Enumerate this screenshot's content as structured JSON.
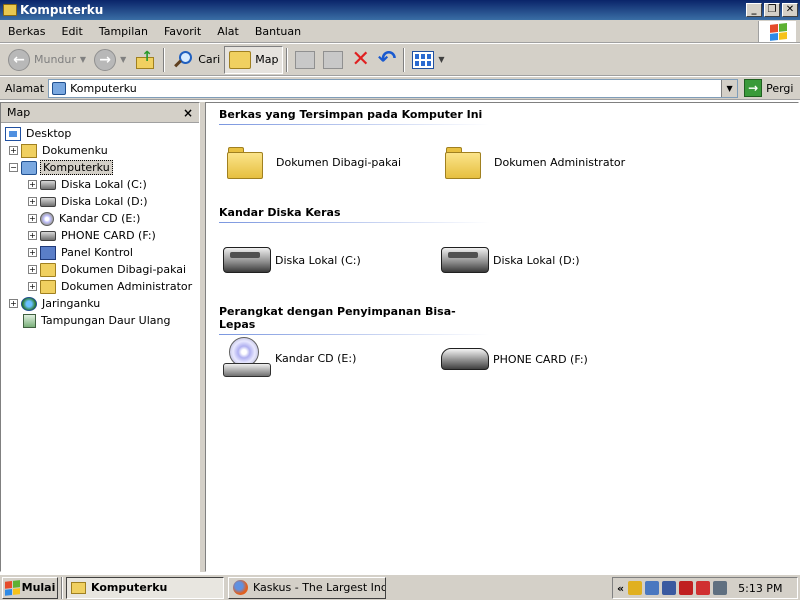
{
  "window": {
    "title": "Komputerku"
  },
  "menu": [
    "Berkas",
    "Edit",
    "Tampilan",
    "Favorit",
    "Alat",
    "Bantuan"
  ],
  "toolbar": {
    "back_label": "Mundur",
    "search_label": "Cari",
    "folders_label": "Map"
  },
  "address": {
    "label": "Alamat",
    "value": "Komputerku",
    "go_label": "Pergi"
  },
  "tree": {
    "header": "Map",
    "items": [
      {
        "label": "Desktop",
        "icon": "desktop-icon"
      },
      {
        "label": "Dokumenku",
        "icon": "documents-icon"
      },
      {
        "label": "Komputerku",
        "icon": "my-computer-icon"
      },
      {
        "label": "Diska Lokal (C:)",
        "icon": "hard-drive-icon"
      },
      {
        "label": "Diska Lokal (D:)",
        "icon": "hard-drive-icon"
      },
      {
        "label": "Kandar CD (E:)",
        "icon": "cd-drive-icon"
      },
      {
        "label": "PHONE CARD (F:)",
        "icon": "removable-drive-icon"
      },
      {
        "label": "Panel Kontrol",
        "icon": "control-panel-icon"
      },
      {
        "label": "Dokumen Dibagi-pakai",
        "icon": "folder-icon"
      },
      {
        "label": "Dokumen Administrator",
        "icon": "folder-icon"
      },
      {
        "label": "Jaringanku",
        "icon": "network-icon"
      },
      {
        "label": "Tampungan Daur Ulang",
        "icon": "recycle-bin-icon"
      }
    ]
  },
  "content": {
    "groups": [
      {
        "title": "Berkas yang Tersimpan pada Komputer Ini",
        "items": [
          {
            "label": "Dokumen Dibagi-pakai",
            "icon": "folder-icon"
          },
          {
            "label": "Dokumen Administrator",
            "icon": "folder-icon"
          }
        ]
      },
      {
        "title": "Kandar Diska Keras",
        "items": [
          {
            "label": "Diska Lokal (C:)",
            "icon": "hard-drive-icon"
          },
          {
            "label": "Diska Lokal (D:)",
            "icon": "hard-drive-icon"
          }
        ]
      },
      {
        "title": "Perangkat dengan Penyimpanan Bisa-Lepas",
        "items": [
          {
            "label": "Kandar CD (E:)",
            "icon": "cd-drive-icon"
          },
          {
            "label": "PHONE CARD (F:)",
            "icon": "removable-drive-icon"
          }
        ]
      }
    ]
  },
  "taskbar": {
    "start_label": "Mulai",
    "tasks": [
      {
        "label": "Komputerku"
      },
      {
        "label": "Kaskus - The Largest Ind..."
      }
    ],
    "clock": "5:13 PM"
  },
  "colors": {
    "titlebar": "#0a246a",
    "face": "#d4d0c8",
    "selection_border": "#000000"
  }
}
